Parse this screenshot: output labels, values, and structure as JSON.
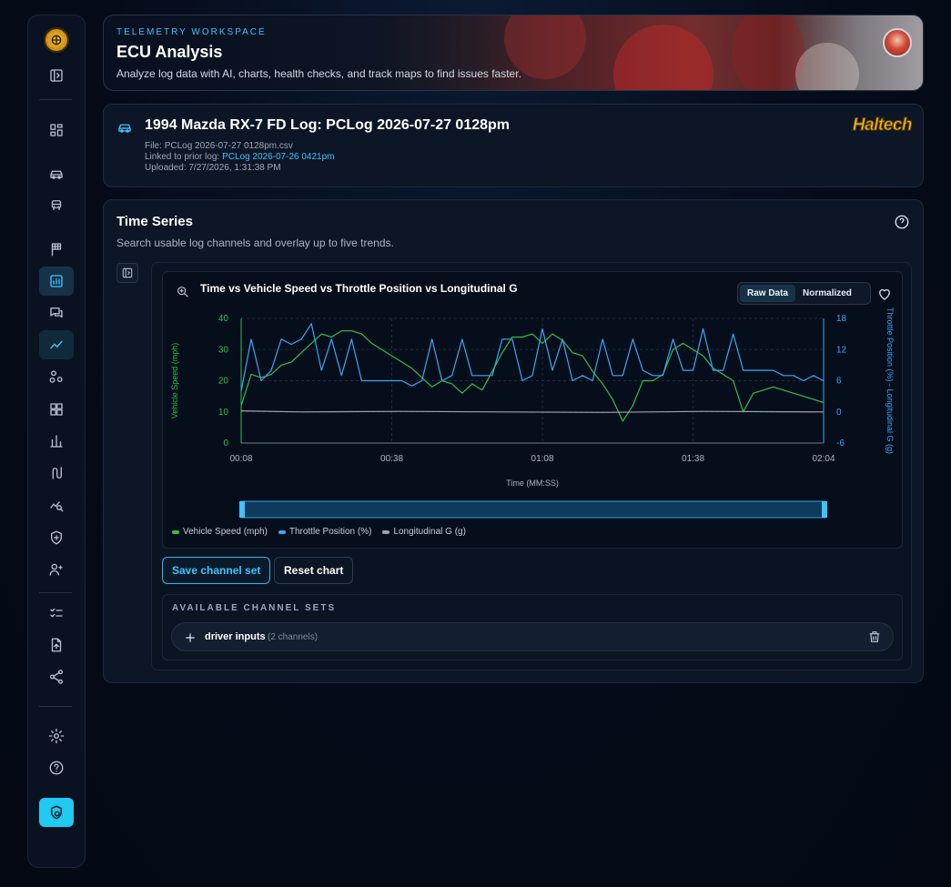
{
  "sidebar": {
    "items": [
      {
        "icon": "logo-icon"
      },
      {
        "icon": "sidebar-toggle-icon"
      },
      {
        "icon": "dashboard-icon"
      },
      {
        "icon": "car-icon"
      },
      {
        "icon": "vehicle-front-icon"
      },
      {
        "icon": "race-flag-icon"
      },
      {
        "icon": "ecu-analysis-icon",
        "active": true
      },
      {
        "icon": "chat-icon"
      },
      {
        "icon": "trend-icon",
        "active": true
      },
      {
        "icon": "nodes-icon"
      },
      {
        "icon": "grid-icon"
      },
      {
        "icon": "bar-chart-icon"
      },
      {
        "icon": "route-icon"
      },
      {
        "icon": "chart-search-icon"
      },
      {
        "icon": "shield-icon"
      },
      {
        "icon": "user-settings-icon"
      },
      {
        "icon": "checklist-icon"
      },
      {
        "icon": "file-upload-icon"
      },
      {
        "icon": "share-icon"
      },
      {
        "icon": "gear-icon"
      },
      {
        "icon": "help-icon"
      },
      {
        "icon": "secure-cta-icon"
      }
    ]
  },
  "header": {
    "kicker": "TELEMETRY WORKSPACE",
    "title": "ECU Analysis",
    "subtitle": "Analyze log data with AI, charts, health checks, and track maps to find issues faster."
  },
  "log": {
    "title": "1994 Mazda RX-7 FD Log: PCLog 2026-07-27 0128pm",
    "file_label": "File:",
    "file": "PCLog 2026-07-27 0128pm.csv",
    "linked_label": "Linked to prior log:",
    "linked": "PCLog 2026-07-26 0421pm",
    "uploaded_label": "Uploaded:",
    "uploaded": "7/27/2026, 1:31:38 PM",
    "brand": "Haltech"
  },
  "panel": {
    "title": "Time Series",
    "subtitle": "Search usable log channels and overlay up to five trends."
  },
  "chart": {
    "title": "Time vs Vehicle Speed vs Throttle Position vs Longitudinal G",
    "mode_raw": "Raw Data",
    "mode_norm": "Normalized"
  },
  "chart_data": {
    "type": "line",
    "xlabel": "Time (MM:SS)",
    "x_ticks": [
      "00:08",
      "00:38",
      "01:08",
      "01:38",
      "02:04"
    ],
    "ylabel_left": "Vehicle Speed (mph)",
    "ylim_left": [
      0,
      40
    ],
    "yticks_left": [
      "40",
      "30",
      "20",
      "10",
      "0"
    ],
    "ylabel_right": "Throttle Position (%) - Longitudinal G (g)",
    "ylim_right": [
      -6,
      18
    ],
    "yticks_right": [
      "18",
      "12",
      "6",
      "0",
      "-6"
    ],
    "series": [
      {
        "name": "Vehicle Speed (mph)",
        "axis": "left",
        "color": "#2fbf4f",
        "x_seconds": [
          8,
          10,
          12,
          14,
          16,
          18,
          20,
          22,
          24,
          26,
          28,
          30,
          32,
          34,
          36,
          38,
          40,
          42,
          44,
          46,
          48,
          50,
          52,
          54,
          56,
          58,
          60,
          62,
          64,
          66,
          68,
          70,
          72,
          74,
          76,
          78,
          80,
          82,
          84,
          86,
          88,
          90,
          92,
          94,
          96,
          98,
          100,
          102,
          104,
          106,
          108,
          110,
          112,
          114,
          116,
          118,
          120,
          122,
          124
        ],
        "values": [
          12,
          22,
          21,
          22,
          25,
          26,
          29,
          32,
          35,
          34,
          36,
          36,
          35,
          32,
          30,
          28,
          26,
          24,
          21,
          18,
          20,
          19,
          16,
          19,
          17,
          23,
          29,
          34,
          34,
          35,
          32,
          35,
          33,
          29,
          28,
          23,
          19,
          14,
          7,
          12,
          20,
          20,
          22,
          30,
          32,
          30,
          28,
          24,
          22,
          20,
          10,
          16,
          17,
          18,
          17,
          16,
          15,
          14,
          13
        ]
      },
      {
        "name": "Throttle Position (%)",
        "axis": "right",
        "color": "#3aa7f5",
        "x_seconds": [
          8,
          10,
          12,
          14,
          16,
          18,
          20,
          22,
          24,
          26,
          28,
          30,
          32,
          34,
          36,
          38,
          40,
          42,
          44,
          46,
          48,
          50,
          52,
          54,
          56,
          58,
          60,
          62,
          64,
          66,
          68,
          70,
          72,
          74,
          76,
          78,
          80,
          82,
          84,
          86,
          88,
          90,
          92,
          94,
          96,
          98,
          100,
          102,
          104,
          106,
          108,
          110,
          112,
          114,
          116,
          118,
          120,
          122,
          124
        ],
        "values": [
          4,
          14,
          6,
          8,
          14,
          13,
          14,
          17,
          8,
          14,
          7,
          14,
          6,
          6,
          6,
          6,
          6,
          5,
          6,
          14,
          6,
          7,
          14,
          7,
          7,
          7,
          14,
          14,
          6,
          7,
          16,
          8,
          14,
          6,
          7,
          6,
          14,
          7,
          7,
          14,
          8,
          7,
          7,
          14,
          8,
          8,
          16,
          8,
          8,
          15,
          8,
          8,
          8,
          8,
          7,
          7,
          6,
          7,
          6
        ]
      },
      {
        "name": "Longitudinal G (g)",
        "axis": "right",
        "color": "#9aa3b2",
        "x_seconds": [
          8,
          20,
          40,
          60,
          80,
          100,
          124
        ],
        "values": [
          0.2,
          0.0,
          0.1,
          0.0,
          -0.1,
          0.1,
          0.0
        ]
      }
    ],
    "legend": "bottom-left",
    "grid": true
  },
  "actions": {
    "save": "Save channel set",
    "reset": "Reset chart"
  },
  "sets": {
    "heading": "AVAILABLE CHANNEL SETS",
    "items": [
      {
        "name": "driver inputs",
        "count": "(2 channels)"
      }
    ]
  }
}
